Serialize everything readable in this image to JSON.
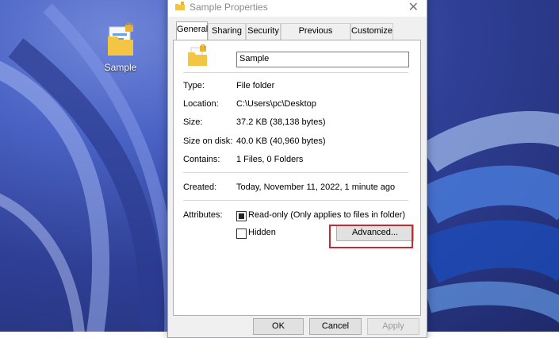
{
  "desktop": {
    "icon_label": "Sample"
  },
  "dialog": {
    "title": "Sample Properties",
    "close_glyph": "✕",
    "tabs": [
      {
        "label": "General",
        "active": true
      },
      {
        "label": "Sharing",
        "active": false
      },
      {
        "label": "Security",
        "active": false
      },
      {
        "label": "Previous Versions",
        "active": false
      },
      {
        "label": "Customize",
        "active": false
      }
    ],
    "name_value": "Sample",
    "properties": {
      "type_label": "Type:",
      "type_value": "File folder",
      "location_label": "Location:",
      "location_value": "C:\\Users\\pc\\Desktop",
      "size_label": "Size:",
      "size_value": "37.2 KB (38,138 bytes)",
      "size_on_disk_label": "Size on disk:",
      "size_on_disk_value": "40.0 KB (40,960 bytes)",
      "contains_label": "Contains:",
      "contains_value": "1 Files, 0 Folders",
      "created_label": "Created:",
      "created_value": "Today, November 11, 2022, 1 minute ago"
    },
    "attributes": {
      "label": "Attributes:",
      "readonly_label": "Read-only (Only applies to files in folder)",
      "readonly_state": "indeterminate",
      "hidden_label": "Hidden",
      "hidden_checked": false,
      "advanced_label": "Advanced..."
    },
    "buttons": {
      "ok": "OK",
      "cancel": "Cancel",
      "apply": "Apply"
    }
  },
  "colors": {
    "highlight": "#c22d33",
    "folder": "#f4c542"
  },
  "icons": [
    "folder-icon",
    "lock-icon",
    "close-icon"
  ]
}
